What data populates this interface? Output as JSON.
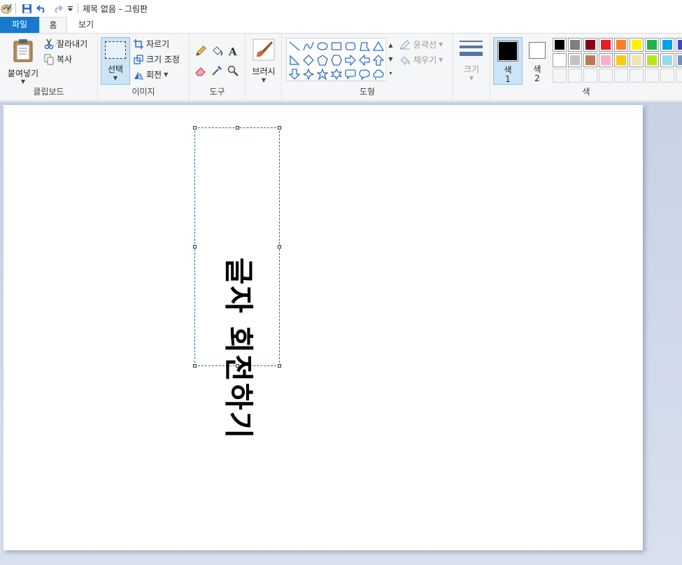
{
  "window": {
    "title": "제목 없음 - 그림판"
  },
  "tabs": {
    "file": "파일",
    "home": "홈",
    "view": "보기"
  },
  "clipboard": {
    "paste": "붙여넣기",
    "cut": "잘라내기",
    "copy": "복사",
    "label": "클립보드"
  },
  "image": {
    "select": "선택",
    "crop": "자르기",
    "resize": "크기 조정",
    "rotate": "회전",
    "label": "이미지"
  },
  "tools": {
    "label": "도구"
  },
  "brushes": {
    "label": "브러시"
  },
  "shapes": {
    "outline": "윤곽선",
    "fill": "채우기",
    "label": "도형"
  },
  "size": {
    "label": "크기"
  },
  "color1": {
    "label_top": "색",
    "label_bottom": "1",
    "value": "#000000"
  },
  "color2": {
    "label_top": "색",
    "label_bottom": "2",
    "value": "#ffffff"
  },
  "colors": {
    "label": "색",
    "row1": [
      "#000000",
      "#7f7f7f",
      "#880015",
      "#ed1c24",
      "#ff7f27",
      "#fff200",
      "#22b14c",
      "#00a2e8",
      "#3f48cc"
    ],
    "row2": [
      "#ffffff",
      "#c3c3c3",
      "#b97a57",
      "#ffaec9",
      "#ffc90e",
      "#efe4b0",
      "#b5e61d",
      "#99d9ea",
      "#7092be"
    ]
  },
  "canvas": {
    "text": "글자 회전하기"
  }
}
